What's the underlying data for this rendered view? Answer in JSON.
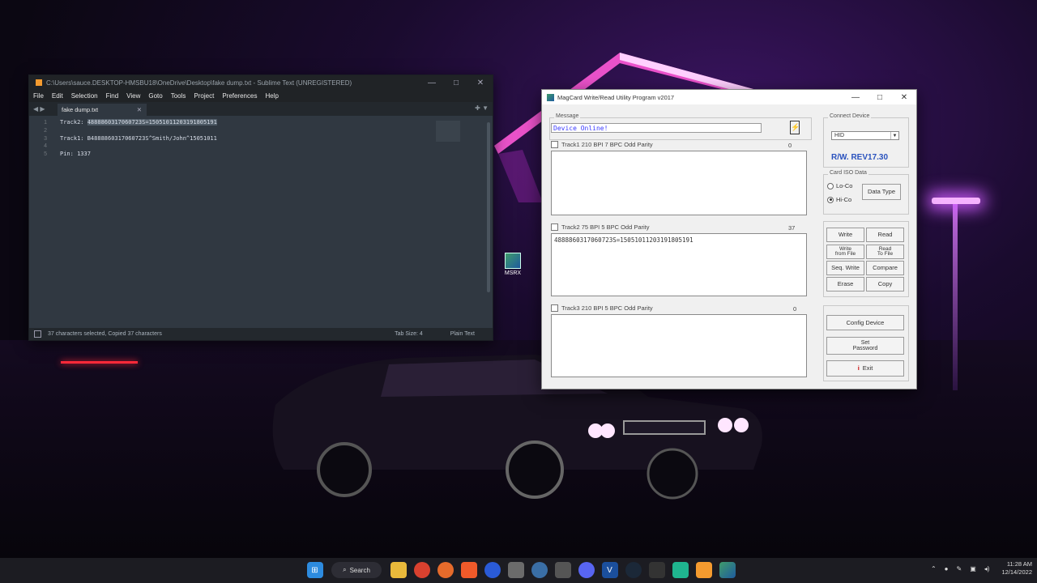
{
  "sublime": {
    "title": "C:\\Users\\sauce.DESKTOP-HMSBU18\\OneDrive\\Desktop\\fake dump.txt - Sublime Text (UNREGISTERED)",
    "menu": [
      "File",
      "Edit",
      "Selection",
      "Find",
      "View",
      "Goto",
      "Tools",
      "Project",
      "Preferences",
      "Help"
    ],
    "tab_name": "fake dump.txt",
    "line_numbers": [
      "1",
      "2",
      "3",
      "4",
      "5"
    ],
    "lines": {
      "l1_prefix": "Track2: ",
      "l1_selected": "4888860317060723S=15051011203191805191",
      "l2": "",
      "l3": "Track1: B4888860317060723S^Smith/John^15051011",
      "l4": "",
      "l5": "Pin: 1337"
    },
    "status_left": "37 characters selected, Copied 37 characters",
    "status_tab_size": "Tab Size: 4",
    "status_syntax": "Plain Text"
  },
  "desktop_icon": {
    "label": "MSRX"
  },
  "magcard": {
    "title": "MagCard Write/Read Utility Program  v2017",
    "message_label": "Message",
    "message_value": "Device Online!",
    "track1_header": "Track1   210 BPI 7 BPC Odd Parity",
    "track1_count": "0",
    "track1_value": "",
    "track2_header": "Track2   75 BPI 5 BPC Odd Parity",
    "track2_count": "37",
    "track2_value": "4888860317060723S=15051011203191805191",
    "track3_header": "Track3   210 BPI 5 BPC Odd Parity",
    "track3_count": "0",
    "track3_value": "",
    "connect_label": "Connect Device",
    "connect_value": "HID",
    "revision": "R/W. REV17.30",
    "card_iso_label": "Card  ISO Data",
    "radio_lo": "Lo-Co",
    "radio_hi": "Hi-Co",
    "data_type_btn": "Data Type",
    "btn_write": "Write",
    "btn_read": "Read",
    "btn_write_file": "Write\nfrom File",
    "btn_read_file": "Read\nTo File",
    "btn_seq_write": "Seq. Write",
    "btn_compare": "Compare",
    "btn_erase": "Erase",
    "btn_copy": "Copy",
    "btn_config": "Config Device",
    "btn_set_password": "Set\nPassword",
    "btn_exit": "Exit"
  },
  "taskbar": {
    "search_label": "Search",
    "time": "11:28 AM",
    "date": "12/14/2022"
  },
  "colors": {
    "sublime_bg": "#303841",
    "magcard_text_blue": "#3a3aff",
    "revision_blue": "#2a52be"
  }
}
